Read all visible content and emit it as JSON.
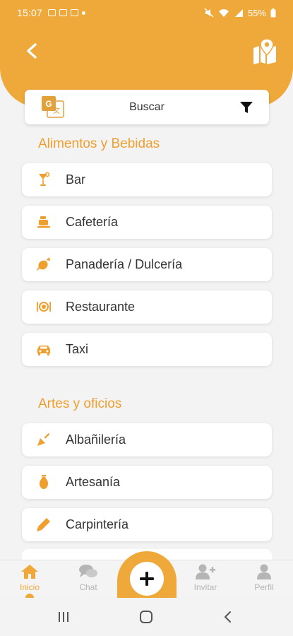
{
  "status_bar": {
    "time": "15:07",
    "battery": "55%"
  },
  "header": {
    "back_icon": "chevron-left-icon",
    "map_icon": "map-pin-icon"
  },
  "search": {
    "label": "Buscar",
    "translate_icon": "google-translate-icon",
    "filter_icon": "filter-icon"
  },
  "sections": [
    {
      "title": "Alimentos y Bebidas",
      "items": [
        {
          "label": "Bar",
          "icon": "cocktail-icon"
        },
        {
          "label": "Cafetería",
          "icon": "coffee-cup-icon"
        },
        {
          "label": "Panadería / Dulcería",
          "icon": "candy-icon"
        },
        {
          "label": "Restaurante",
          "icon": "plate-cutlery-icon"
        },
        {
          "label": "Taxi",
          "icon": "car-icon"
        }
      ]
    },
    {
      "title": "Artes y oficios",
      "items": [
        {
          "label": "Albañilería",
          "icon": "trowel-icon"
        },
        {
          "label": "Artesanía",
          "icon": "vase-icon"
        },
        {
          "label": "Carpintería",
          "icon": "pencil-icon"
        }
      ]
    }
  ],
  "bottom_nav": {
    "home": "Inicio",
    "chat": "Chat",
    "invite": "Invitar",
    "profile": "Perfil"
  },
  "colors": {
    "accent": "#efa83a",
    "section_title": "#ef9f2d"
  }
}
